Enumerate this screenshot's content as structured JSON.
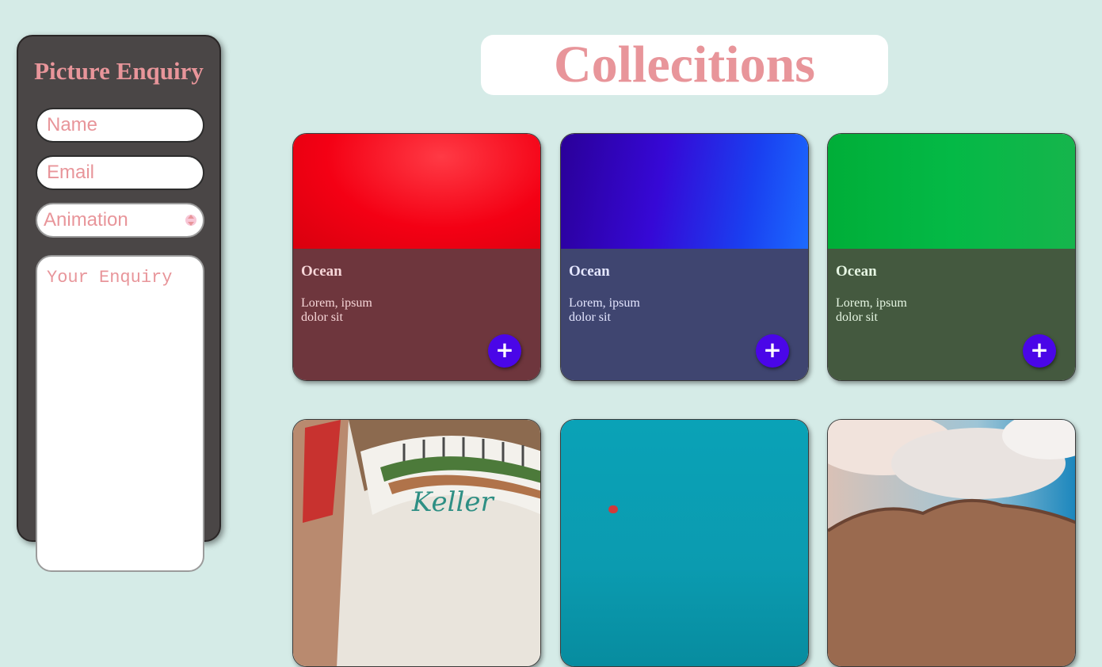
{
  "sidebar": {
    "title": "Picture Enquiry",
    "name_placeholder": "Name",
    "email_placeholder": "Email",
    "select_value": "Animation",
    "enquiry_placeholder": "Your Enquiry"
  },
  "header": {
    "title": "Collecitions"
  },
  "cards": [
    {
      "title": "Ocean",
      "text": "Lorem, ipsum dolor sit",
      "button": "+",
      "image": "red-texture",
      "overlay_color": "#6e363d",
      "title_color": "#f6d6d8"
    },
    {
      "title": "Ocean",
      "text": "Lorem, ipsum dolor sit",
      "button": "+",
      "image": "blue-texture",
      "overlay_color": "#3f4570",
      "title_color": "#e4e6ff"
    },
    {
      "title": "Ocean",
      "text": "Lorem, ipsum dolor sit",
      "button": "+",
      "image": "green-texture",
      "overlay_color": "#44593f",
      "title_color": "#e6f6e3"
    },
    {
      "image": "building-facade-photo"
    },
    {
      "image": "teal-water-photo"
    },
    {
      "image": "sky-mountain-photo"
    }
  ],
  "colors": {
    "background": "#d5ebe7",
    "accent_pink": "#e8959a",
    "button_purple": "#4a06e8",
    "sidebar": "#4a4646"
  }
}
